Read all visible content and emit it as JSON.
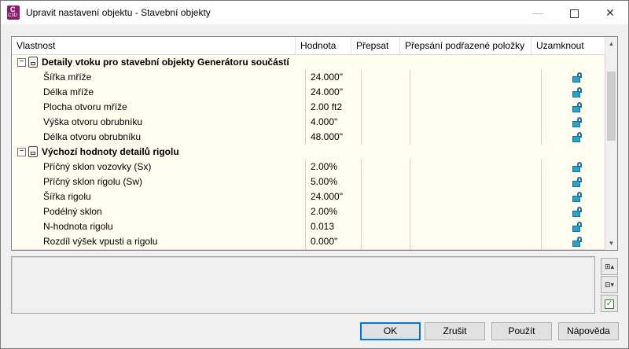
{
  "window": {
    "title": "Upravit nastavení objektu - Stavební objekty",
    "app_icon_letter": "C",
    "app_icon_version": "C3D"
  },
  "grid": {
    "headers": {
      "property": "Vlastnost",
      "value": "Hodnota",
      "override": "Přepsat",
      "child_override": "Přepsání podřazené položky",
      "lock": "Uzamknout"
    },
    "categories": [
      {
        "name": "Detaily vtoku pro stavební objekty Generátoru součástí",
        "expander": "−",
        "rows": [
          {
            "name": "Šířka mříže",
            "value": "24.000\""
          },
          {
            "name": "Délka mříže",
            "value": "24.000\""
          },
          {
            "name": "Plocha otvoru mříže",
            "value": "2.00 ft2"
          },
          {
            "name": "Výška otvoru obrubníku",
            "value": "4.000\""
          },
          {
            "name": "Délka otvoru obrubníku",
            "value": "48.000\""
          }
        ]
      },
      {
        "name": "Výchozí hodnoty detailů rigolu",
        "expander": "−",
        "rows": [
          {
            "name": "Příčný sklon vozovky (Sx)",
            "value": "2.00%"
          },
          {
            "name": "Příčný sklon rigolu (Sw)",
            "value": "5.00%"
          },
          {
            "name": "Šířka rigolu",
            "value": "24.000\""
          },
          {
            "name": "Podélný sklon",
            "value": "2.00%"
          },
          {
            "name": "N-hodnota rigolu",
            "value": "0.013"
          },
          {
            "name": "Rozdíl výšek vpusti a rigolu",
            "value": "0.000\""
          }
        ]
      }
    ]
  },
  "buttons": {
    "ok": "OK",
    "cancel": "Zrušit",
    "apply": "Použít",
    "help": "Nápověda"
  },
  "icons": {
    "lock": "unlocked-padlock-icon",
    "category": "category-icon",
    "expand_all": "expand-all-icon",
    "collapse_all": "collapse-all-icon",
    "checkbox": "checkbox-icon"
  },
  "colors": {
    "row_background": "#fffdf0",
    "row_border": "#f0c8d8",
    "default_button_border": "#0078d7",
    "lock_color": "#2aa3c9"
  }
}
